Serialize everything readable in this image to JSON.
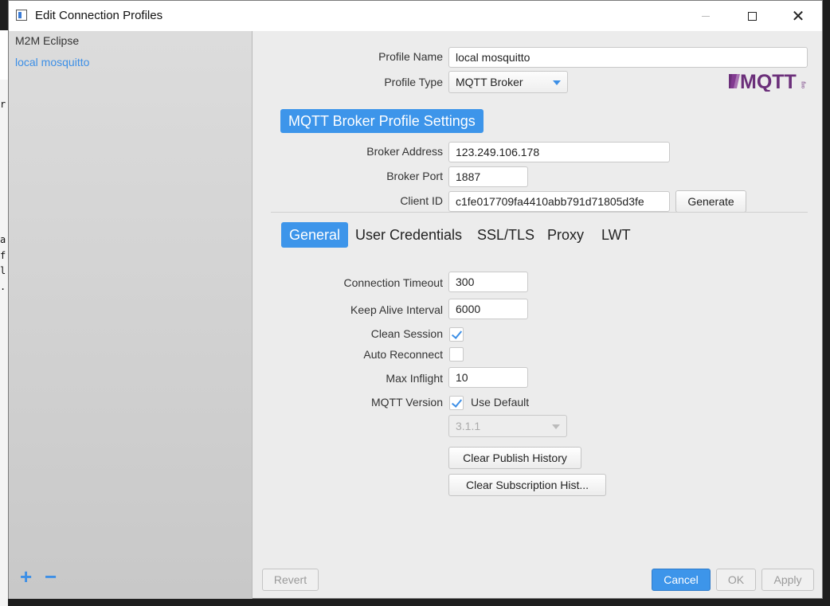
{
  "window": {
    "title": "Edit Connection Profiles",
    "minimize": "—",
    "close": "✕"
  },
  "background_chars": [
    "r",
    "a",
    "f",
    "l",
    ".:"
  ],
  "sidebar": {
    "items": [
      {
        "label": "M2M Eclipse",
        "active": false
      },
      {
        "label": "local mosquitto",
        "active": true
      }
    ],
    "add_label": "+",
    "remove_label": "−"
  },
  "profile": {
    "name_label": "Profile Name",
    "name_value": "local mosquitto",
    "type_label": "Profile Type",
    "type_value": "MQTT Broker",
    "logo_text": "MQTT",
    "logo_org": "org"
  },
  "broker": {
    "section_title": "MQTT Broker Profile Settings",
    "address_label": "Broker Address",
    "address_value": "123.249.106.178",
    "port_label": "Broker Port",
    "port_value": "1887",
    "client_id_label": "Client ID",
    "client_id_value": "c1fe017709fa4410abb791d71805d3fe",
    "generate_label": "Generate"
  },
  "tabs": [
    {
      "label": "General",
      "active": true
    },
    {
      "label": "User Credentials",
      "active": false
    },
    {
      "label": "SSL/TLS",
      "active": false
    },
    {
      "label": "Proxy",
      "active": false
    },
    {
      "label": "LWT",
      "active": false
    }
  ],
  "general": {
    "timeout_label": "Connection Timeout",
    "timeout_value": "300",
    "keepalive_label": "Keep Alive Interval",
    "keepalive_value": "6000",
    "clean_session_label": "Clean Session",
    "clean_session_checked": true,
    "auto_reconnect_label": "Auto Reconnect",
    "auto_reconnect_checked": false,
    "max_inflight_label": "Max Inflight",
    "max_inflight_value": "10",
    "mqtt_version_label": "MQTT Version",
    "use_default_label": "Use Default",
    "use_default_checked": true,
    "version_value": "3.1.1",
    "clear_publish_label": "Clear Publish History",
    "clear_subscription_label": "Clear Subscription Hist..."
  },
  "footer": {
    "revert_label": "Revert",
    "cancel_label": "Cancel",
    "ok_label": "OK",
    "apply_label": "Apply"
  },
  "colors": {
    "accent": "#3d95ea",
    "sidebar_bg": "#d4d4d4",
    "panel_bg": "#ececec",
    "logo": "#6b2f7a"
  }
}
